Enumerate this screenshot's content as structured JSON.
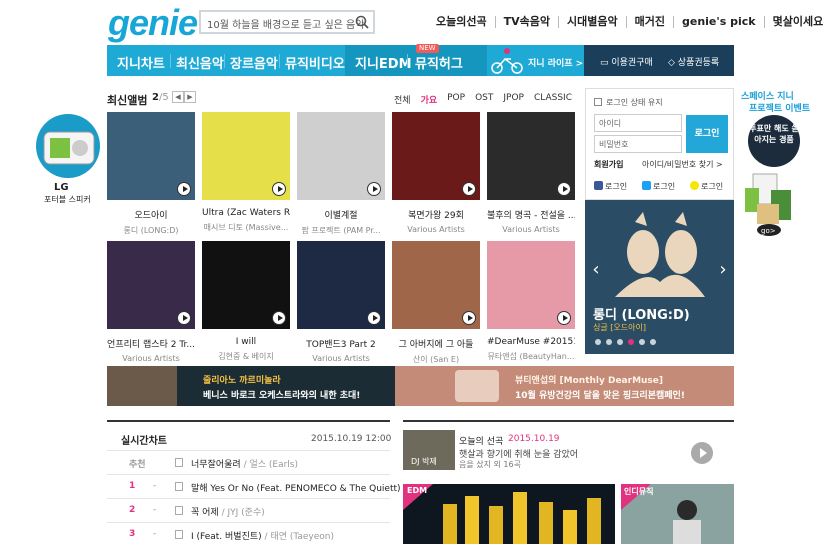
{
  "header": {
    "logo": "genie",
    "search_placeholder": "10월 하늘을 배경으로 듣고 싶은 음악",
    "topnav": [
      "오늘의선곡",
      "TV속음악",
      "시대별음악",
      "매거진",
      "genie's pick",
      "몇살이세요"
    ]
  },
  "menu": {
    "items": [
      "지니차트",
      "최신음악",
      "장르음악",
      "뮤직비디오",
      "지니EDM",
      "뮤직허그"
    ],
    "new_badge": "NEW",
    "life": "지니 라이프 >",
    "buy": "이용권구매",
    "register": "상품권등록"
  },
  "new_albums": {
    "title": "최신앨범",
    "page": "2",
    "total": "/5",
    "prev": "◀",
    "next": "▶",
    "genres": [
      "전체",
      "가요",
      "POP",
      "OST",
      "JPOP",
      "CLASSIC"
    ],
    "active_genre": "가요",
    "albums": [
      {
        "title": "오드아이",
        "artist": "롱디 (LONG:D)",
        "color": "#3b5f78"
      },
      {
        "title": "Ultra (Zac Waters Re...",
        "artist": "매시브 디토 (Massive...",
        "color": "#e5e04a"
      },
      {
        "title": "이별계절",
        "artist": "팜 프로젝트 (PAM Pr...",
        "color": "#cfcfcf"
      },
      {
        "title": "복면가왕 29회",
        "artist": "Various Artists",
        "color": "#6b1a1a"
      },
      {
        "title": "불후의 명곡 - 전설을 ...",
        "artist": "Various Artists",
        "color": "#2b2b2b"
      },
      {
        "title": "언프리티 랩스타 2 Tr...",
        "artist": "Various Artists",
        "color": "#3a2a4a"
      },
      {
        "title": "I will",
        "artist": "김현중 & 베이지",
        "color": "#111111"
      },
      {
        "title": "TOP밴드3 Part 2",
        "artist": "Various Artists",
        "color": "#1e2a44"
      },
      {
        "title": "그 아버지에 그 아들",
        "artist": "산이 (San E)",
        "color": "#a0664a"
      },
      {
        "title": "#DearMuse #201510...",
        "artist": "뮤타앤섭 (BeautyHan...",
        "color": "#e69aa8"
      }
    ]
  },
  "login": {
    "keep": "로그인 상태 유지",
    "id": "아이디",
    "password": "비밀번호",
    "button": "로그인",
    "join": "회원가입",
    "find": "아이디/비밀번호 찾기 >",
    "sns": [
      "로그인",
      "로그인",
      "로그인"
    ]
  },
  "feature": {
    "title": "롱디 (LONG:D)",
    "subtitle": "싱글 [오드아이]",
    "dots": 6,
    "active_dot": 3
  },
  "banners": {
    "left_line1": "줄리아노 까르미놀라",
    "left_line2": "베니스 바로크 오케스트라와의 내한 초대!",
    "right_line1": "뷰티앤섭의 [Monthly DearMuse]",
    "right_line2": "10월 유방건강의 달을 맞은 핑크리본캠페인!"
  },
  "chart": {
    "title": "실시간차트",
    "date": "2015.10.19 12:00",
    "rows": [
      {
        "rank": "추천",
        "change": "",
        "title": "너무잘어울려",
        "artist": "얼스 (Earls)"
      },
      {
        "rank": "1",
        "change": "-",
        "title": "말해 Yes Or No (Feat. PENOMECO & The Quiett)",
        "artist": ""
      },
      {
        "rank": "2",
        "change": "-",
        "title": "꼭 어제",
        "artist": "JYJ (준수)"
      },
      {
        "rank": "3",
        "change": "-",
        "title": "I (Feat. 버벌진트)",
        "artist": "태연 (Taeyeon)"
      }
    ]
  },
  "today": {
    "dj": "DJ 박제",
    "title": "오늘의 선곡",
    "date": "2015.10.19",
    "text": "햇살과 향기에 취해 눈을 감았어",
    "count": "음을 샀지 외 16곡",
    "edm": "EDM",
    "indie": "인디뮤직"
  },
  "ads": {
    "left_title": "LG",
    "left_sub": "포터블 스피커",
    "right_t1": "스페이스 지니",
    "right_t2": "프로젝트 이벤트",
    "right_circle": "투표만 해도 쏟아지는 경품",
    "right_go": "go>"
  }
}
